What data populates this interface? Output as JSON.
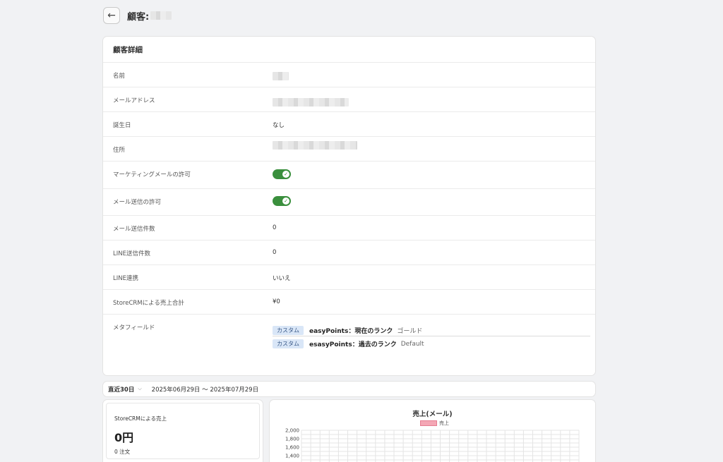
{
  "header": {
    "title": "顧客:"
  },
  "detail": {
    "title": "顧客詳細",
    "rows": {
      "name": {
        "label": "名前"
      },
      "email": {
        "label": "メールアドレス"
      },
      "birthday": {
        "label": "誕生日",
        "value": "なし"
      },
      "address": {
        "label": "住所"
      },
      "marketing": {
        "label": "マーケティングメールの許可",
        "enabled": true
      },
      "mail_allow": {
        "label": "メール送信の許可",
        "enabled": true
      },
      "mail_count": {
        "label": "メール送信件数",
        "value": "0"
      },
      "line_count": {
        "label": "LINE送信件数",
        "value": "0"
      },
      "line_link": {
        "label": "LINE連携",
        "value": "いいえ"
      },
      "sales_total": {
        "label": "StoreCRMによる売上合計",
        "value": "¥0"
      },
      "metafield": {
        "label": "メタフィールド",
        "items": [
          {
            "tag": "カスタム",
            "key": "easyPoints：現在のランク",
            "value": "ゴールド"
          },
          {
            "tag": "カスタム",
            "key": "esasyPoints：過去のランク",
            "value": "Default"
          }
        ]
      }
    }
  },
  "date_bar": {
    "range_label": "直近30日",
    "range_text": "2025年06月29日 〜 2025年07月29日"
  },
  "sales_card": {
    "label": "StoreCRMによる売上",
    "value": "0円",
    "orders": "0 注文"
  },
  "chart_data": {
    "type": "line",
    "title": "売上(メール)",
    "series": [
      {
        "name": "売上",
        "values": []
      }
    ],
    "ylim": [
      0,
      2000
    ],
    "yticks": [
      2000,
      1800,
      1600,
      1400
    ],
    "ytick_labels": [
      "2,000",
      "1,800",
      "1,600",
      "1,400"
    ],
    "grid": true,
    "legend": "top",
    "colors": {
      "series": "#f4a7b5"
    }
  }
}
